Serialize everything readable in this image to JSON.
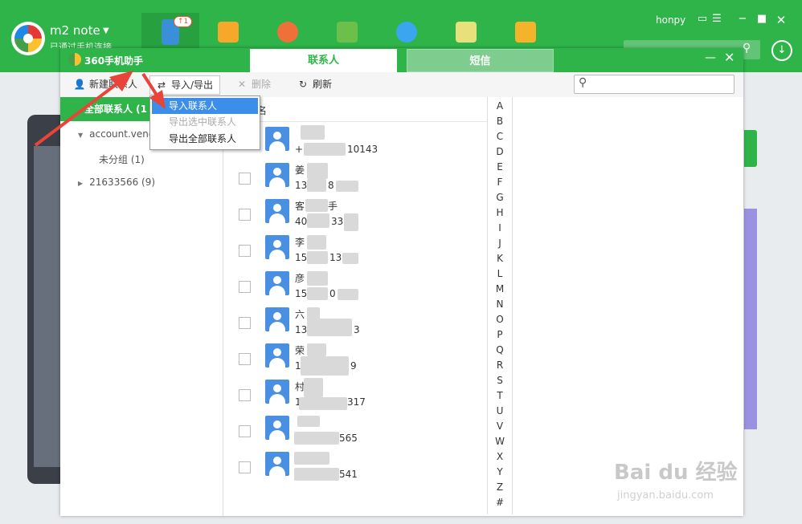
{
  "topbar": {
    "device_name": "m2 note",
    "device_status": "已通过手机连接",
    "user": "honpy",
    "badge": "↑1"
  },
  "window": {
    "app_name": "360手机助手",
    "tab_contacts": "联系人",
    "tab_sms": "短信"
  },
  "toolbar": {
    "new_contact": "新建联系人",
    "import_export": "导入/导出",
    "delete": "删除",
    "refresh": "刷新"
  },
  "groups": {
    "all": "全部联系人 (1",
    "account": "account.vend",
    "ungrouped": "未分组 (1)",
    "other": "21633566 (9)"
  },
  "list": {
    "name_header": "名"
  },
  "contacts": [
    {
      "name": "",
      "phone": "+",
      "phone_tail": "10143"
    },
    {
      "name": "姜",
      "phone": "13",
      "phone_tail": "8"
    },
    {
      "name": "客",
      "phone": "40",
      "phone_tail": "33",
      "name_tail": "手"
    },
    {
      "name": "李",
      "phone": "15",
      "phone_tail": "13"
    },
    {
      "name": "彦",
      "phone": "15",
      "phone_tail": "0"
    },
    {
      "name": "六",
      "phone": "13",
      "phone_tail": "3"
    },
    {
      "name": "荣",
      "phone": "1",
      "phone_tail": "9"
    },
    {
      "name": "村",
      "phone": "1",
      "phone_tail": "317"
    },
    {
      "name": "",
      "phone": "",
      "phone_tail": "565"
    },
    {
      "name": "",
      "phone": "",
      "phone_tail": "541"
    }
  ],
  "alphabet": [
    "A",
    "B",
    "C",
    "D",
    "E",
    "F",
    "G",
    "H",
    "I",
    "J",
    "K",
    "L",
    "M",
    "N",
    "O",
    "P",
    "Q",
    "R",
    "S",
    "T",
    "U",
    "V",
    "W",
    "X",
    "Y",
    "Z",
    "#"
  ],
  "dropdown": {
    "import": "导入联系人",
    "export_selected": "导出选中联系人",
    "export_all": "导出全部联系人"
  },
  "watermark": {
    "logo": "Bai du 经验",
    "url": "jingyan.baidu.com"
  },
  "colors": {
    "brand_green": "#2fb44a",
    "highlight_blue": "#3c8ee8",
    "arrow_red": "#e8443a"
  }
}
